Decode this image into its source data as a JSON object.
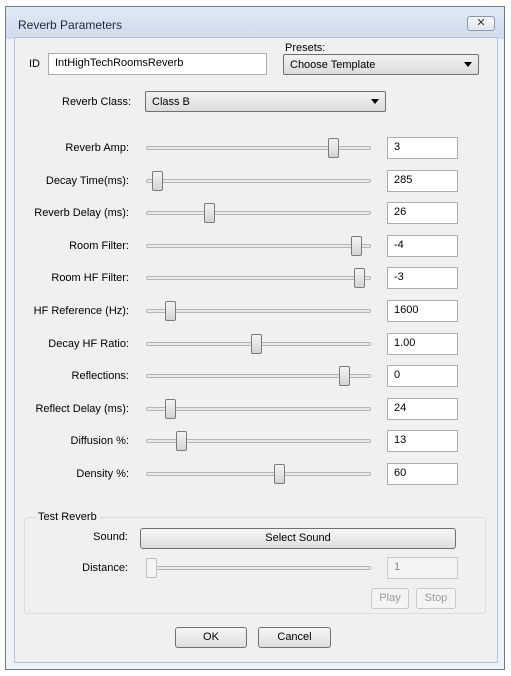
{
  "window": {
    "title": "Reverb Parameters",
    "close_glyph": "✕"
  },
  "id_field": {
    "label": "ID",
    "value": "IntHighTechRoomsReverb"
  },
  "presets": {
    "label": "Presets:",
    "value": "Choose Template"
  },
  "reverb_class": {
    "label": "Reverb Class:",
    "value": "Class B"
  },
  "params": [
    {
      "label": "Reverb Amp:",
      "value": "3",
      "slider_fraction": 0.85
    },
    {
      "label": "Decay Time(ms):",
      "value": "285",
      "slider_fraction": 0.03
    },
    {
      "label": "Reverb Delay (ms):",
      "value": "26",
      "slider_fraction": 0.27
    },
    {
      "label": "Room Filter:",
      "value": "-4",
      "slider_fraction": 0.96
    },
    {
      "label": "Room HF Filter:",
      "value": "-3",
      "slider_fraction": 0.97
    },
    {
      "label": "HF Reference (Hz):",
      "value": "1600",
      "slider_fraction": 0.09
    },
    {
      "label": "Decay HF Ratio:",
      "value": "1.00",
      "slider_fraction": 0.49
    },
    {
      "label": "Reflections:",
      "value": "0",
      "slider_fraction": 0.9
    },
    {
      "label": "Reflect Delay (ms):",
      "value": "24",
      "slider_fraction": 0.09
    },
    {
      "label": "Diffusion %:",
      "value": "13",
      "slider_fraction": 0.14
    },
    {
      "label": "Density %:",
      "value": "60",
      "slider_fraction": 0.6
    }
  ],
  "test_reverb": {
    "title": "Test Reverb",
    "sound_label": "Sound:",
    "select_sound": "Select Sound",
    "distance_label": "Distance:",
    "distance_value": "1",
    "distance_fraction": 0.0,
    "play": "Play",
    "stop": "Stop"
  },
  "footer": {
    "ok": "OK",
    "cancel": "Cancel"
  }
}
